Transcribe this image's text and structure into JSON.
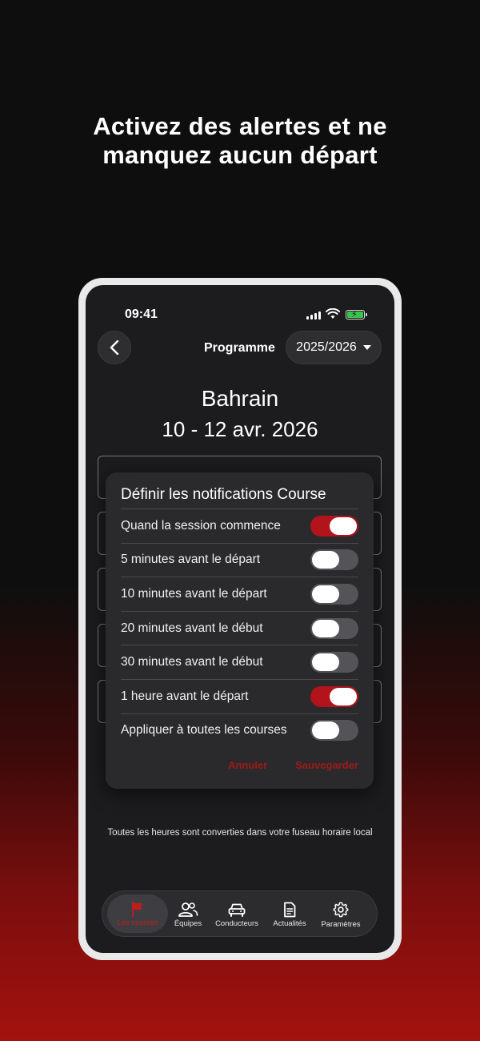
{
  "headline": {
    "line1": "Activez des alertes et ne",
    "line2": "manquez aucun départ"
  },
  "status_bar": {
    "time": "09:41"
  },
  "header": {
    "program_label": "Programme",
    "season": "2025/2026"
  },
  "race": {
    "name": "Bahrain",
    "dates": "10 - 12 avr. 2026"
  },
  "dialog": {
    "title": "Définir les notifications Course",
    "options": [
      {
        "label": "Quand la session commence",
        "on": true
      },
      {
        "label": "5 minutes avant le départ",
        "on": false
      },
      {
        "label": "10 minutes avant le départ",
        "on": false
      },
      {
        "label": "20 minutes avant le début",
        "on": false
      },
      {
        "label": "30 minutes avant le début",
        "on": false
      },
      {
        "label": "1 heure avant le départ",
        "on": true
      },
      {
        "label": "Appliquer à toutes les courses",
        "on": false
      }
    ],
    "cancel_label": "Annuler",
    "save_label": "Sauvegarder"
  },
  "footer_note": "Toutes les heures sont converties dans votre fuseau horaire local",
  "tabs": [
    {
      "label": "Les courses",
      "icon": "flag-icon",
      "active": true
    },
    {
      "label": "Équipes",
      "icon": "people-icon",
      "active": false
    },
    {
      "label": "Conducteurs",
      "icon": "car-icon",
      "active": false
    },
    {
      "label": "Actualités",
      "icon": "news-icon",
      "active": false
    },
    {
      "label": "Paramètres",
      "icon": "gear-icon",
      "active": false
    }
  ],
  "colors": {
    "accent": "#b3131a",
    "toggle_off": "#545458",
    "dialog_bg": "#2a2a2d",
    "screen_bg": "#1c1c1e"
  }
}
